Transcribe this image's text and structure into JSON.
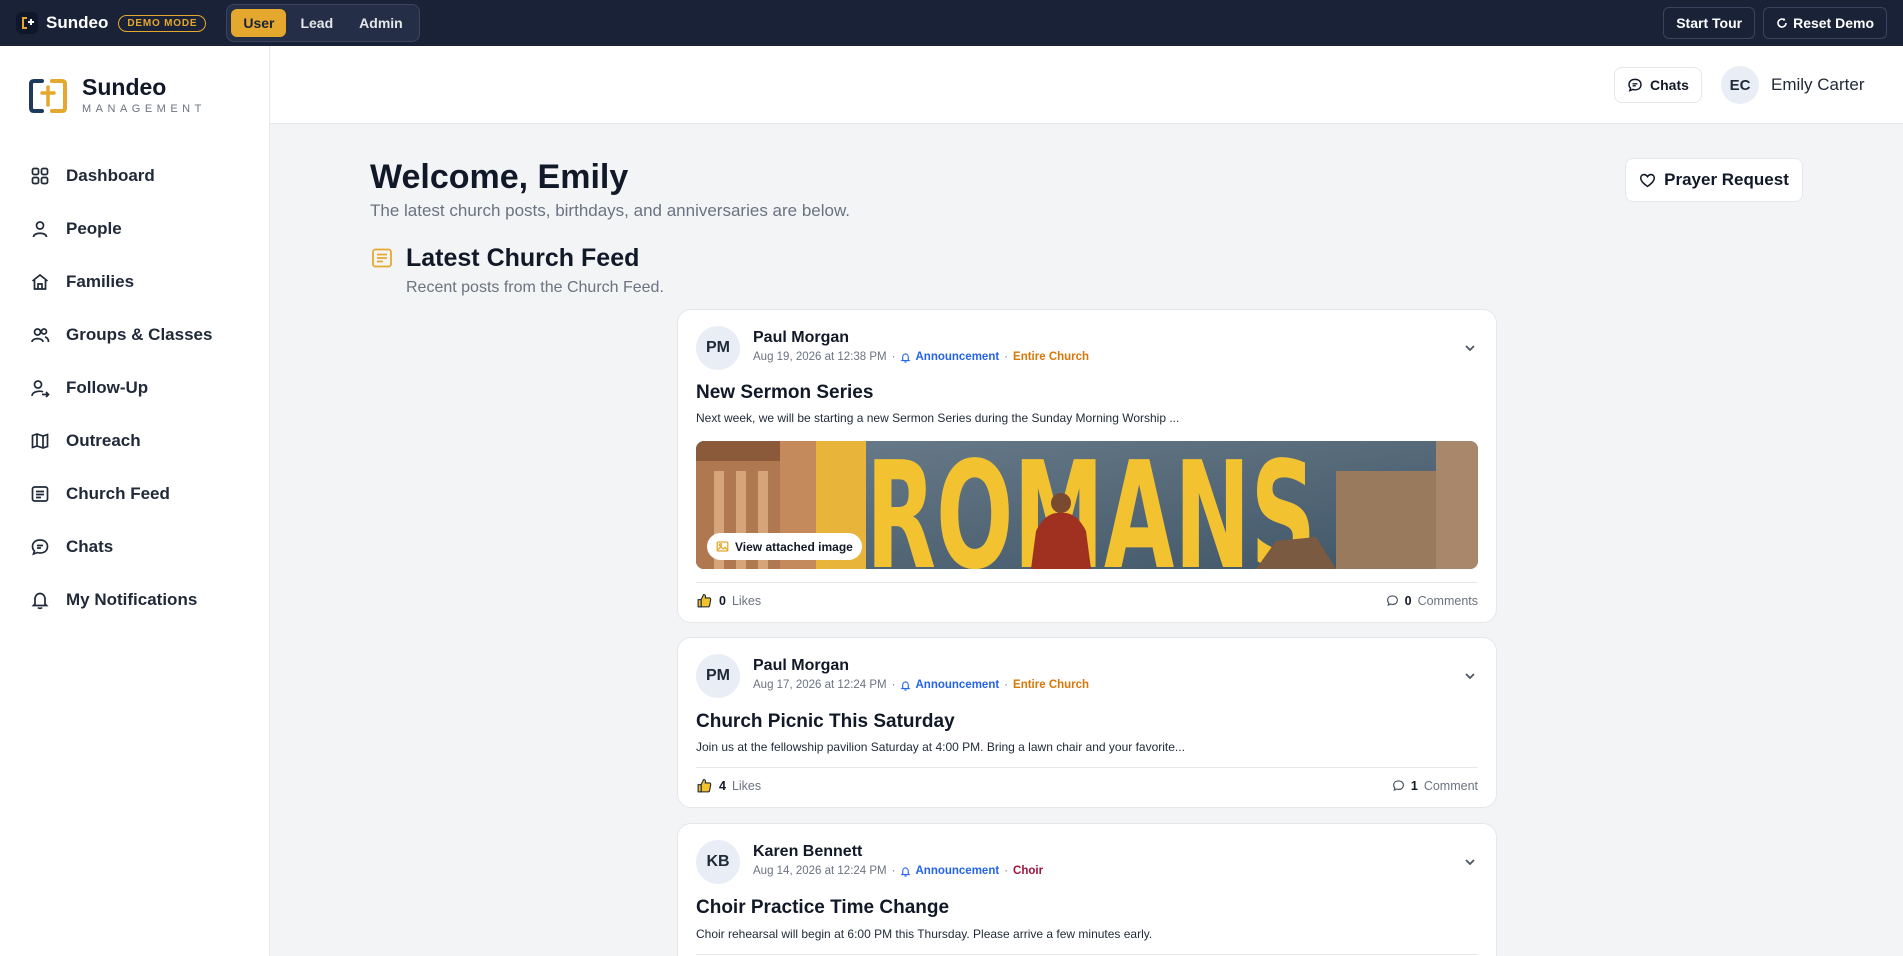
{
  "topbar": {
    "brand": "Sundeo",
    "demo_badge": "DEMO MODE",
    "roles": [
      "User",
      "Lead",
      "Admin"
    ],
    "active_role": "User",
    "start_tour": "Start Tour",
    "reset_demo": "Reset Demo"
  },
  "sidebar": {
    "brand_name": "Sundeo",
    "brand_sub": "MANAGEMENT",
    "items": [
      {
        "label": "Dashboard",
        "icon": "grid-icon"
      },
      {
        "label": "People",
        "icon": "person-icon"
      },
      {
        "label": "Families",
        "icon": "home-icon"
      },
      {
        "label": "Groups & Classes",
        "icon": "users-icon"
      },
      {
        "label": "Follow-Up",
        "icon": "user-arrow-icon"
      },
      {
        "label": "Outreach",
        "icon": "map-icon"
      },
      {
        "label": "Church Feed",
        "icon": "feed-icon"
      },
      {
        "label": "Chats",
        "icon": "chat-icon"
      },
      {
        "label": "My Notifications",
        "icon": "bell-icon"
      }
    ]
  },
  "header": {
    "chats_label": "Chats",
    "user_initials": "EC",
    "user_name": "Emily Carter"
  },
  "main": {
    "welcome_title": "Welcome, Emily",
    "welcome_sub": "The latest church posts, birthdays, and anniversaries are below.",
    "prayer_request": "Prayer Request",
    "feed_title": "Latest Church Feed",
    "feed_sub": "Recent posts from the Church Feed."
  },
  "posts": [
    {
      "initials": "PM",
      "author": "Paul Morgan",
      "date": "Aug 19, 2026 at 12:38 PM",
      "category": "Announcement",
      "audience": "Entire Church",
      "audience_color": "#d97706",
      "title": "New Sermon Series",
      "body": "Next week, we will be starting a new Sermon Series during the Sunday Morning Worship ...",
      "image_text": "ROMANS",
      "view_image": "View attached image",
      "likes": "0",
      "likes_label": "Likes",
      "comments": "0",
      "comments_label": "Comments"
    },
    {
      "initials": "PM",
      "author": "Paul Morgan",
      "date": "Aug 17, 2026 at 12:24 PM",
      "category": "Announcement",
      "audience": "Entire Church",
      "audience_color": "#d97706",
      "title": "Church Picnic This Saturday",
      "body": "Join us at the fellowship pavilion Saturday at 4:00 PM. Bring a lawn chair and your favorite...",
      "likes": "4",
      "likes_label": "Likes",
      "comments": "1",
      "comments_label": "Comment"
    },
    {
      "initials": "KB",
      "author": "Karen Bennett",
      "date": "Aug 14, 2026 at 12:24 PM",
      "category": "Announcement",
      "audience": "Choir",
      "audience_color": "#9f1239",
      "title": "Choir Practice Time Change",
      "body": "Choir rehearsal will begin at 6:00 PM this Thursday. Please arrive a few minutes early."
    }
  ],
  "colors": {
    "accent": "#e5a82e",
    "topbar": "#1a2238",
    "link_blue": "#2563eb"
  }
}
